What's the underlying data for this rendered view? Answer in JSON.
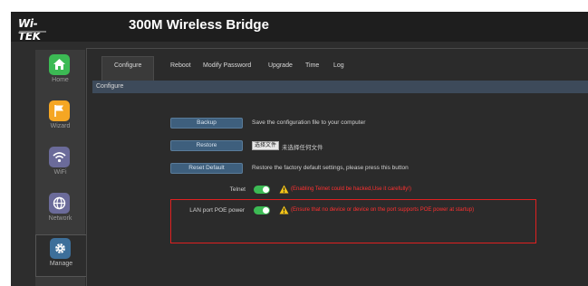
{
  "brand": {
    "logo_text": "Wi-TEK"
  },
  "header": {
    "title": "300M Wireless Bridge"
  },
  "sidebar": {
    "items": [
      {
        "label": "Home",
        "icon": "home-icon",
        "color": "#3cba54"
      },
      {
        "label": "Wizard",
        "icon": "flag-icon",
        "color": "#f5a623"
      },
      {
        "label": "WiFi",
        "icon": "wifi-icon",
        "color": "#6b6b9a"
      },
      {
        "label": "Network",
        "icon": "globe-icon",
        "color": "#6b6b9a"
      },
      {
        "label": "Manage",
        "icon": "gear-icon",
        "color": "#3d6f9a",
        "active": true
      }
    ]
  },
  "tabs": [
    {
      "label": "Configure",
      "active": true
    },
    {
      "label": "Reboot"
    },
    {
      "label": "Modify Password"
    },
    {
      "label": "Upgrade"
    },
    {
      "label": "Time"
    },
    {
      "label": "Log"
    }
  ],
  "breadcrumb": "Configure",
  "actions": {
    "backup": {
      "label": "Backup",
      "description": "Save the configuration file to your computer"
    },
    "restore": {
      "label": "Restore",
      "file_button": "选择文件",
      "file_status": "未选择任何文件"
    },
    "reset": {
      "label": "Reset Default",
      "description": "Restore the factory default settings, please press this button"
    }
  },
  "telnet": {
    "label": "Telnet",
    "enabled": true,
    "warning": "(Enabling Telnet could be hacked,Use it carefully!)"
  },
  "poe": {
    "label": "LAN port POE power",
    "enabled": true,
    "warning": "(Ensure that no device or device on the port supports POE power at startup)"
  },
  "colors": {
    "toggle_on": "#3cba54",
    "warning_text": "#ff3030",
    "warning_icon": "#f5c518",
    "highlight_box": "#e02020",
    "button": "#3e5f7d"
  }
}
